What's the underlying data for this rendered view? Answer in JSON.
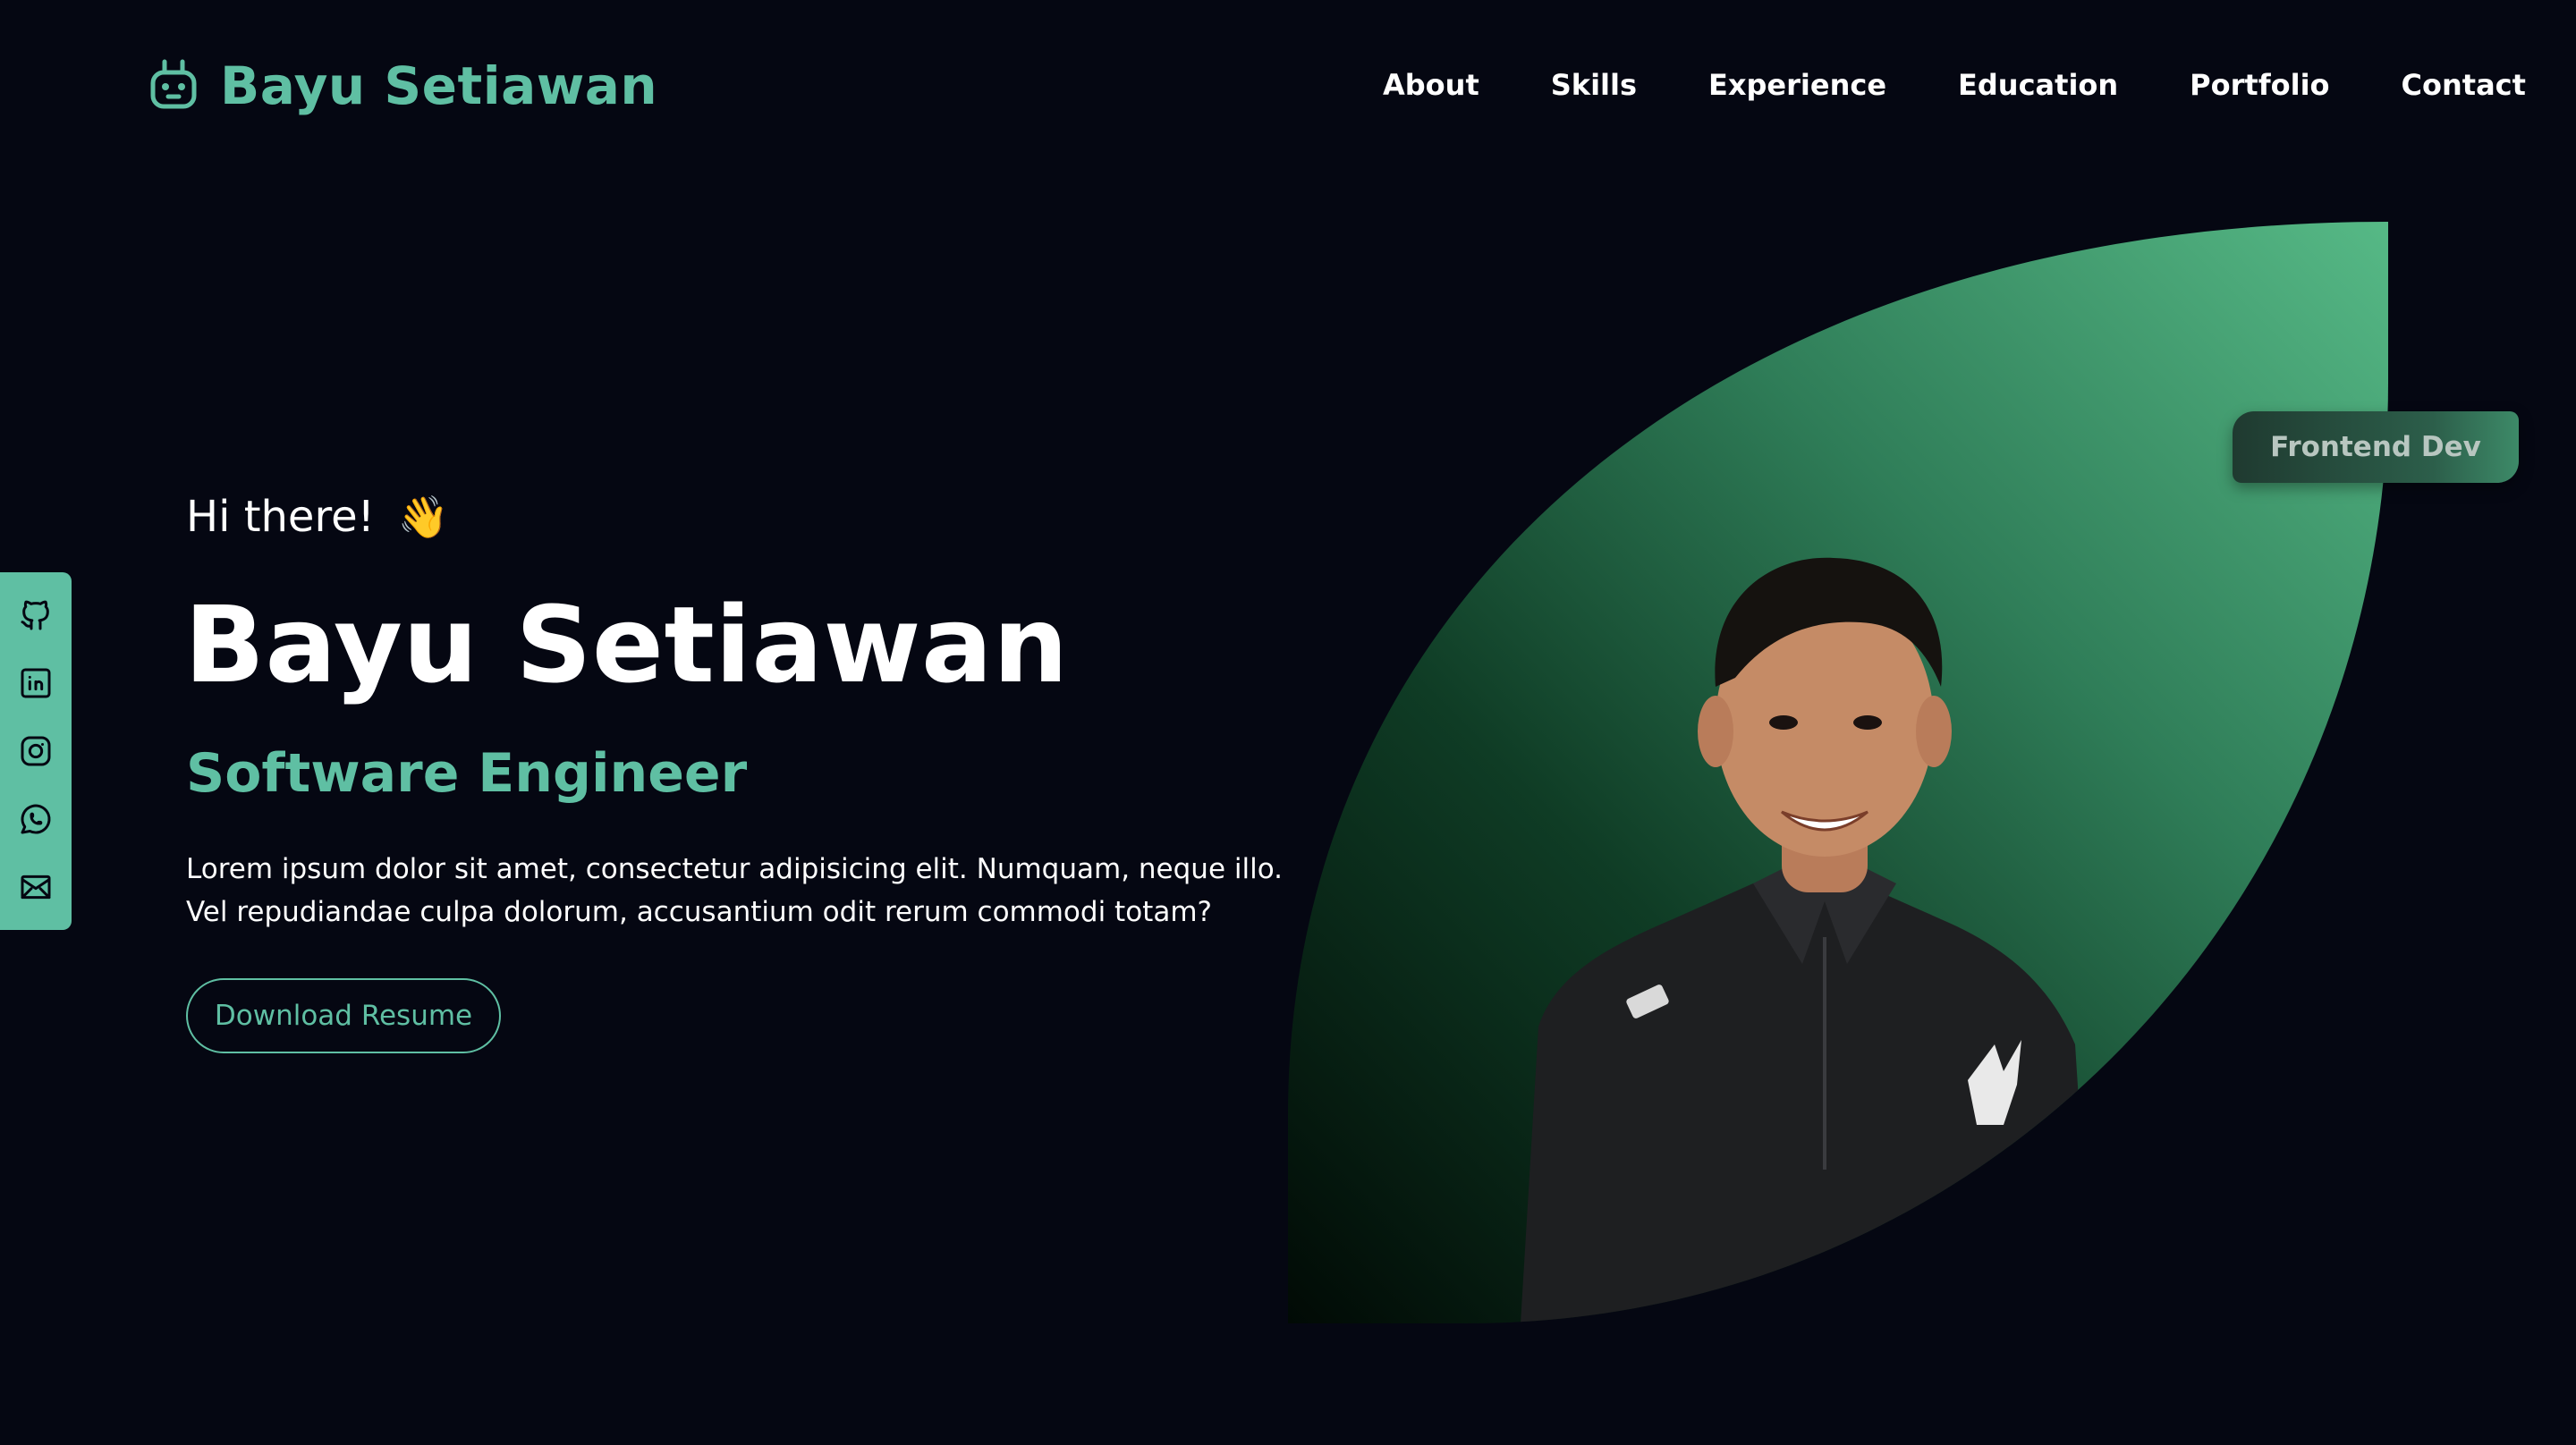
{
  "brand": {
    "name": "Bayu Setiawan",
    "icon": "robot-icon"
  },
  "nav": [
    {
      "label": "About"
    },
    {
      "label": "Skills"
    },
    {
      "label": "Experience"
    },
    {
      "label": "Education"
    },
    {
      "label": "Portfolio"
    },
    {
      "label": "Contact"
    }
  ],
  "social": [
    {
      "icon": "github-icon"
    },
    {
      "icon": "linkedin-icon"
    },
    {
      "icon": "instagram-icon"
    },
    {
      "icon": "whatsapp-icon"
    },
    {
      "icon": "mail-icon"
    }
  ],
  "hero": {
    "greeting": "Hi there!",
    "wave_emoji": "👋",
    "name": "Bayu Setiawan",
    "role": "Software Engineer",
    "description": "Lorem ipsum dolor sit amet, consectetur adipisicing elit. Numquam, neque illo. Vel repudiandae culpa dolorum, accusantium odit rerum commodi totam?",
    "resume_button": "Download Resume",
    "badge": "Frontend Dev"
  },
  "colors": {
    "background": "#050712",
    "accent": "#5fbfa3",
    "leaf_light": "#52b383",
    "leaf_dark": "#031a10"
  }
}
